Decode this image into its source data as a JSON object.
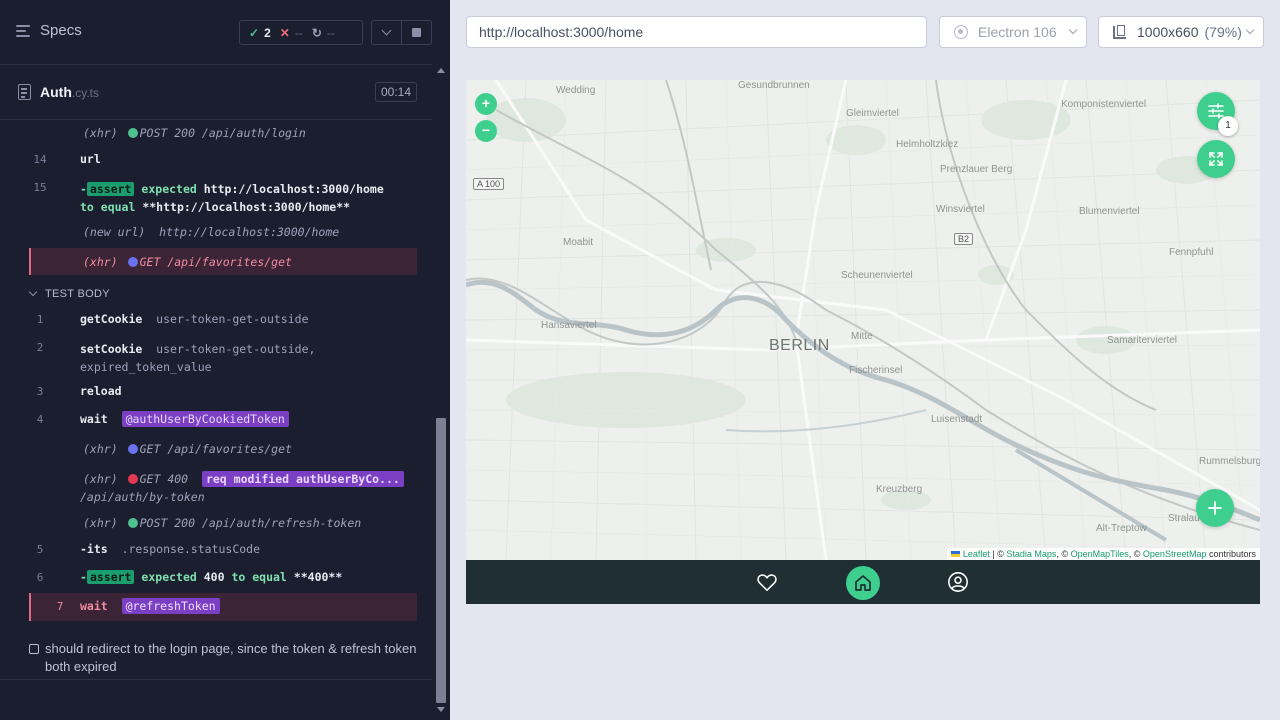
{
  "runner": {
    "specs_label": "Specs",
    "stats": {
      "passed": "2",
      "failed": "--",
      "pending": "--"
    },
    "file": {
      "name": "Auth",
      "ext": ".cy.ts",
      "duration": "00:14"
    },
    "log_top": [
      {
        "kind": "xhr",
        "xhr": "(xhr)",
        "status": "green",
        "text": "POST 200 /api/auth/login"
      },
      {
        "kind": "cmd",
        "num": "14",
        "cmd": "url",
        "arg": ""
      },
      {
        "kind": "assert",
        "num": "15",
        "prefix": "-",
        "tag": "assert",
        "line1a": "expected",
        "line1b": "http://localhost:3000/home",
        "line2a": "to equal",
        "line2b": "**http://localhost:3000/home**"
      },
      {
        "kind": "newurl",
        "label": "(new url)",
        "text": "http://localhost:3000/home"
      },
      {
        "kind": "xhr-hl",
        "xhr": "(xhr)",
        "status": "blue",
        "text": "GET /api/favorites/get"
      }
    ],
    "section_title": "TEST BODY",
    "test_body": {
      "l1": {
        "num": "1",
        "cmd": "getCookie",
        "arg": "user-token-get-outside"
      },
      "l2": {
        "num": "2",
        "cmd": "setCookie",
        "arg1": "user-token-get-outside,",
        "arg2": "expired_token_value"
      },
      "l3": {
        "num": "3",
        "cmd": "reload"
      },
      "l4": {
        "num": "4",
        "cmd": "wait",
        "alias": "@authUserByCookiedToken"
      },
      "x1": {
        "xhr": "(xhr)",
        "text": "GET /api/favorites/get"
      },
      "x2": {
        "xhr": "(xhr)",
        "text": "GET 400",
        "alias": "req modified authUserByCo...",
        "path": "/api/auth/by-token"
      },
      "x3": {
        "xhr": "(xhr)",
        "text": "POST 200 /api/auth/refresh-token"
      },
      "l5": {
        "num": "5",
        "cmd": "-its",
        "arg": ".response.statusCode"
      },
      "l6": {
        "num": "6",
        "prefix": "-",
        "tag": "assert",
        "a": "expected",
        "b": "400",
        "c": "to equal",
        "d": "**400**"
      },
      "l7": {
        "num": "7",
        "cmd": "wait",
        "alias": "@refreshToken"
      }
    },
    "test_title": "should redirect to the login page, since the token & refresh token both expired"
  },
  "preview": {
    "url": "http://localhost:3000/home",
    "browser": "Electron 106",
    "viewport": "1000x660",
    "viewport_display": "1000x660",
    "zoom": "(79%)"
  },
  "map": {
    "city": "BERLIN",
    "labels": [
      "Wedding",
      "Gesundbrunnen",
      "Gleimviertel",
      "Komponistenviertel",
      "Helmholtzkiez",
      "Prenzlauer Berg",
      "Winsviertel",
      "Blumenviertel",
      "Moabit",
      "Fennpfuhl",
      "Scheunenviertel",
      "Hansaviertel",
      "Mitte",
      "Fischerinsel",
      "Samariterviertel",
      "Luisenstadt",
      "Kreuzberg",
      "Rummelsburg",
      "Alt-Treptow",
      "Stralau"
    ],
    "road_shields": [
      "A 100",
      "B2"
    ],
    "filter_badge": "1",
    "zoom_in": "+",
    "zoom_out": "−",
    "attribution": {
      "leaflet": "Leaflet",
      "sep1": " | © ",
      "stadia": "Stadia Maps",
      "sep2": ", © ",
      "omt": "OpenMapTiles",
      "sep3": ", © ",
      "osm": "OpenStreetMap",
      "tail": " contributors"
    }
  },
  "colors": {
    "accent": "#3ecf8e",
    "runner_bg": "#1b1e2e",
    "fail": "#e23a52",
    "pass": "#4ec18f",
    "alias": "#7b3fc4"
  },
  "icons": [
    "menu-icon",
    "check-icon",
    "x-icon",
    "spinner-icon",
    "chevron-down-icon",
    "stop-icon",
    "file-icon",
    "electron-icon",
    "ruler-icon",
    "filter-icon",
    "fullscreen-icon",
    "plus-icon",
    "heart-icon",
    "home-icon",
    "user-icon"
  ]
}
